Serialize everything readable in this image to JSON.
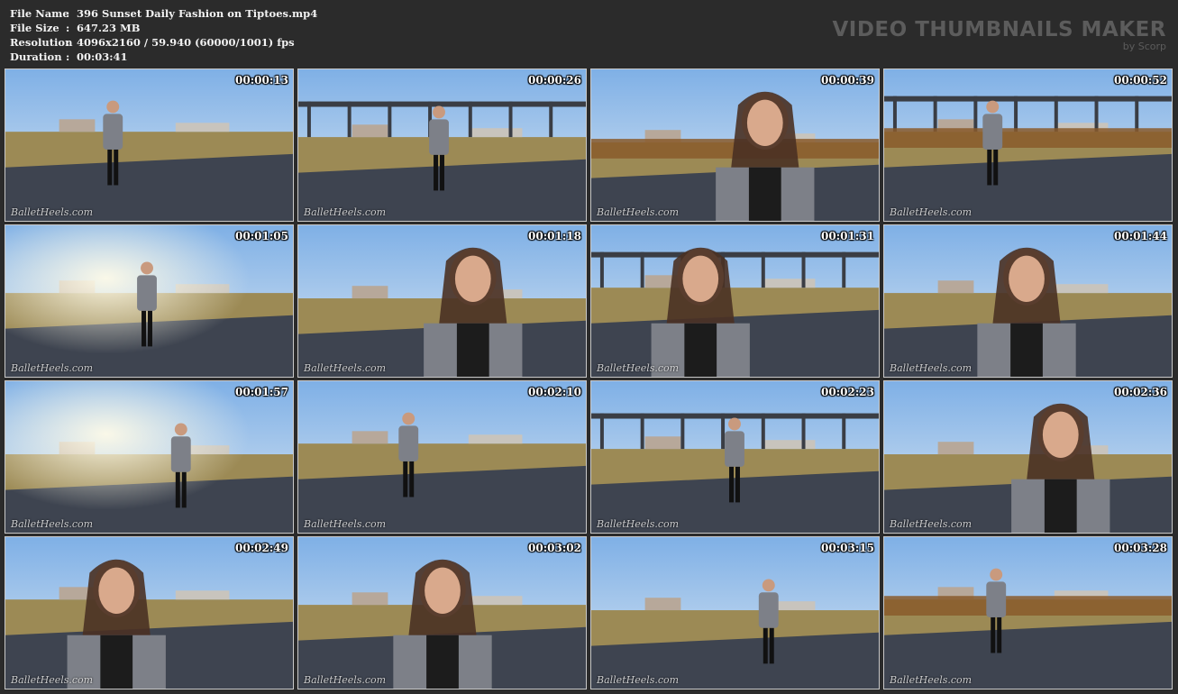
{
  "file_info": [
    {
      "label": "File Name",
      "sep": ":",
      "value": "396 Sunset Daily Fashion on Tiptoes.mp4"
    },
    {
      "label": "File Size",
      "sep": ":",
      "value": "647.23 MB"
    },
    {
      "label": "Resolution",
      "sep": ":",
      "value": "4096x2160 / 59.940 (60000/1001) fps"
    },
    {
      "label": "Duration",
      "sep": ":",
      "value": "00:03:41"
    }
  ],
  "brand": {
    "title": "VIDEO THUMBNAILS MAKER",
    "subtitle": "by Scorp"
  },
  "watermark_text": "BalletHeels.com",
  "colors": {
    "sky_top": "#7fb0e6",
    "sky_bottom": "#d9e6f2",
    "field": "#9c8a55",
    "road": "#3e4450",
    "steel": "#3a3d44",
    "rust": "#8a5a2c"
  },
  "thumbnails": [
    {
      "time": "00:00:13",
      "scene": "far-walk"
    },
    {
      "time": "00:00:26",
      "scene": "bridge-walk"
    },
    {
      "time": "00:00:39",
      "scene": "train-portrait"
    },
    {
      "time": "00:00:52",
      "scene": "crane-walk"
    },
    {
      "time": "00:01:05",
      "scene": "sun-legs"
    },
    {
      "time": "00:01:18",
      "scene": "closeup"
    },
    {
      "time": "00:01:31",
      "scene": "bridge-portrait"
    },
    {
      "time": "00:01:44",
      "scene": "side-portrait"
    },
    {
      "time": "00:01:57",
      "scene": "sun-back"
    },
    {
      "time": "00:02:10",
      "scene": "road-walk"
    },
    {
      "time": "00:02:23",
      "scene": "bridge-walk2"
    },
    {
      "time": "00:02:36",
      "scene": "closeup2"
    },
    {
      "time": "00:02:49",
      "scene": "legs-closeup"
    },
    {
      "time": "00:03:02",
      "scene": "profile"
    },
    {
      "time": "00:03:15",
      "scene": "field-walk"
    },
    {
      "time": "00:03:28",
      "scene": "track-walk"
    }
  ]
}
